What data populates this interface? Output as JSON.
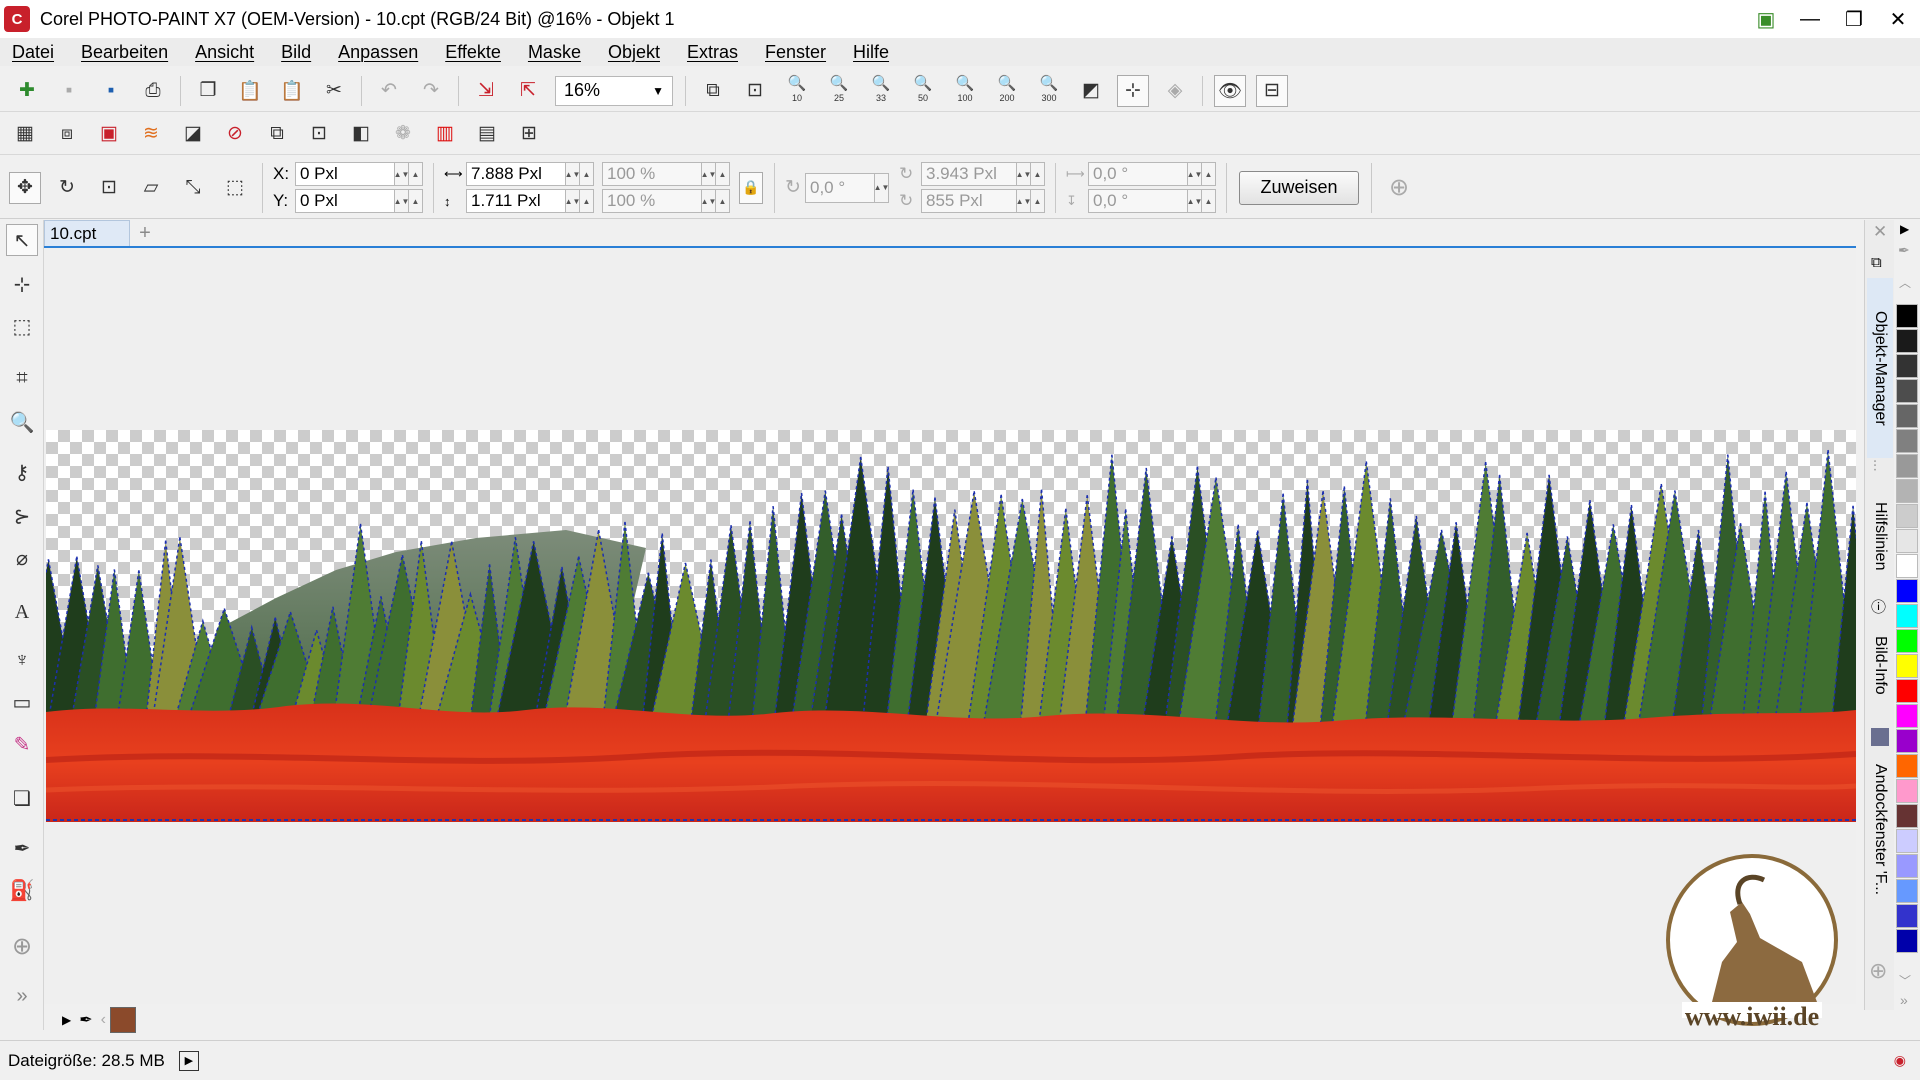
{
  "window": {
    "title": "Corel PHOTO-PAINT X7 (OEM-Version) - 10.cpt (RGB/24 Bit) @16% - Objekt 1"
  },
  "menu": [
    "Datei",
    "Bearbeiten",
    "Ansicht",
    "Bild",
    "Anpassen",
    "Effekte",
    "Maske",
    "Objekt",
    "Extras",
    "Fenster",
    "Hilfe"
  ],
  "toolbar": {
    "zoom": "16%",
    "zoom_levels": [
      "10",
      "25",
      "33",
      "50",
      "100",
      "200",
      "300"
    ]
  },
  "properties": {
    "x_label": "X:",
    "x_value": "0 Pxl",
    "y_label": "Y:",
    "y_value": "0 Pxl",
    "width": "7.888 Pxl",
    "height": "1.711 Pxl",
    "scale_w": "100 %",
    "scale_h": "100 %",
    "rotation": "0,0 °",
    "center_x": "3.943 Pxl",
    "center_y": "855 Pxl",
    "skew_h": "0,0 °",
    "skew_v": "0,0 °",
    "assign_button": "Zuweisen"
  },
  "document": {
    "tab": "10.cpt"
  },
  "dockers": [
    "Objekt-Manager",
    "Hilfslinien",
    "Bild-Info",
    "Andockfenster 'F..."
  ],
  "palette": [
    "#000000",
    "#1a1a1a",
    "#333333",
    "#4d4d4d",
    "#666666",
    "#808080",
    "#999999",
    "#b3b3b3",
    "#cccccc",
    "#e6e6e6",
    "#ffffff",
    "#0000ff",
    "#00ffff",
    "#00ff00",
    "#ffff00",
    "#ff0000",
    "#ff00ff",
    "#9900cc",
    "#ff6600",
    "#ff99cc",
    "#663333",
    "#ccccff",
    "#9999ff",
    "#6699ff",
    "#3333cc",
    "#0000aa"
  ],
  "fill_color": "#8b4a2b",
  "status": {
    "filesize": "Dateigröße: 28.5 MB"
  },
  "watermark": "www.iwii.de"
}
